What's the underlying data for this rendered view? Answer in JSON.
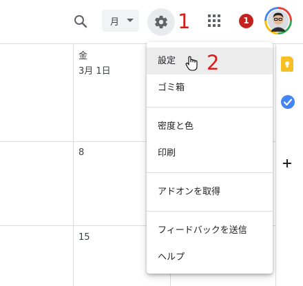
{
  "header": {
    "view_label": "月",
    "notification_count": "1",
    "search_icon": "search-icon",
    "settings_icon": "gear-icon",
    "apps_icon": "apps-grid-icon"
  },
  "annotations": {
    "step1": "1",
    "step2": "2"
  },
  "calendar": {
    "day_label": "金",
    "date_label": "3月 1日",
    "week2_date": "8",
    "week3_date": "15"
  },
  "settings_menu": {
    "items": [
      {
        "label": "設定"
      },
      {
        "label": "ゴミ箱"
      },
      {
        "label": "密度と色"
      },
      {
        "label": "印刷"
      },
      {
        "label": "アドオンを取得"
      },
      {
        "label": "フィードバックを送信"
      },
      {
        "label": "ヘルプ"
      }
    ]
  },
  "side_panel": {
    "icons": [
      "keep-icon",
      "tasks-icon",
      "add-icon"
    ]
  },
  "colors": {
    "annotation_red": "#d81b1b",
    "badge_red": "#c5221f",
    "keep_yellow": "#f6bf26",
    "tasks_blue": "#4285f4"
  }
}
